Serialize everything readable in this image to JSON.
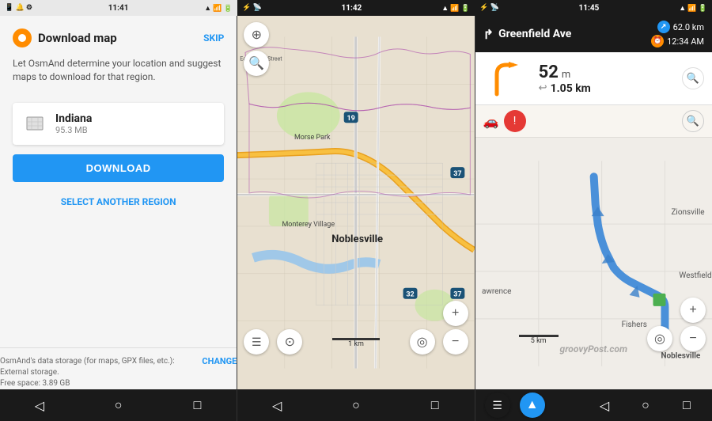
{
  "panels": {
    "panel1": {
      "status": {
        "time": "11:41",
        "icons": "📶🔋"
      },
      "title": "Download map",
      "skip_label": "SKIP",
      "description": "Let OsmAnd determine your location and suggest maps to download for that region.",
      "map_card": {
        "name": "Indiana",
        "size": "95.3 MB"
      },
      "download_button": "DOWNLOAD",
      "select_region": "SELECT ANOTHER REGION",
      "footer": {
        "text": "OsmAnd's data storage (for maps, GPX files, etc.): External storage.\nFree space: 3.89 GB",
        "change": "CHANGE"
      }
    },
    "panel2": {
      "status": {
        "time": "11:42"
      },
      "scale": "1 km",
      "nav_buttons": {
        "menu": "☰",
        "compass": "⊕",
        "location": "◎",
        "minus": "−"
      }
    },
    "panel3": {
      "status": {
        "time": "11:45"
      },
      "street_name": "Greenfield Ave",
      "distance_km": "62.0 km",
      "time": "12:34 AM",
      "maneuver": {
        "distance": "52",
        "unit": "m",
        "total": "1.05 km"
      },
      "cities": [
        "Zionsville",
        "Westfield",
        "Fishers",
        "Noblesville",
        "awrence"
      ],
      "scale": "5 km"
    }
  }
}
